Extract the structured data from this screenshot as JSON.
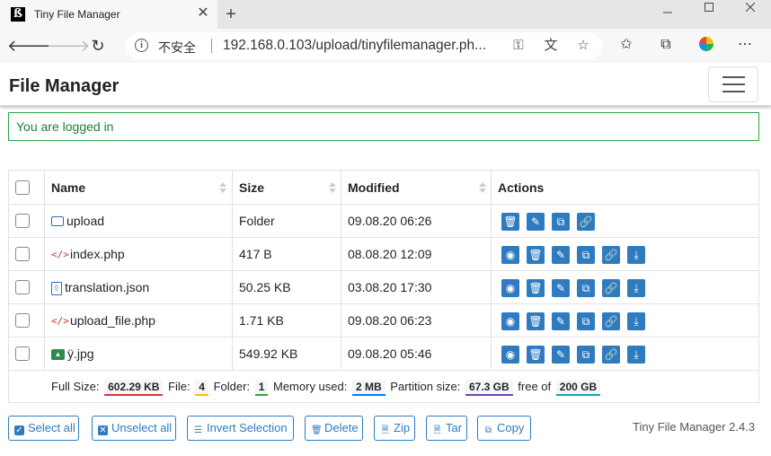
{
  "browser": {
    "tab_title": "Tiny File Manager",
    "tab_close": "✕",
    "new_tab": "+",
    "favicon_text": "ß",
    "security_label": "不安全",
    "url": "192.168.0.103/upload/tinyfilemanager.ph..."
  },
  "app": {
    "brand": "File Manager",
    "alert": "You are logged in"
  },
  "table": {
    "headers": {
      "name": "Name",
      "size": "Size",
      "modified": "Modified",
      "actions": "Actions"
    },
    "rows": [
      {
        "name": "upload",
        "icon": "folder-icon",
        "size": "Folder",
        "modified": "09.08.20 06:26",
        "actions": [
          "delete",
          "rename",
          "copy",
          "link"
        ]
      },
      {
        "name": "index.php",
        "icon": "code-file-icon",
        "size": "417 B",
        "modified": "08.08.20 12:09",
        "actions": [
          "view",
          "delete",
          "rename",
          "copy",
          "link",
          "download"
        ]
      },
      {
        "name": "translation.json",
        "icon": "json-file-icon",
        "size": "50.25 KB",
        "modified": "03.08.20 17:30",
        "actions": [
          "view",
          "delete",
          "rename",
          "copy",
          "link",
          "download"
        ]
      },
      {
        "name": "upload_file.php",
        "icon": "code-file-icon",
        "size": "1.71 KB",
        "modified": "09.08.20 06:23",
        "actions": [
          "view",
          "delete",
          "rename",
          "copy",
          "link",
          "download"
        ]
      },
      {
        "name": "ÿ.jpg",
        "icon": "image-file-icon",
        "size": "549.92 KB",
        "modified": "09.08.20 05:46",
        "actions": [
          "view",
          "delete",
          "rename",
          "copy",
          "link",
          "download"
        ]
      }
    ],
    "footer": {
      "full_size_label": "Full Size:",
      "full_size": "602.29 KB",
      "file_label": "File:",
      "file_count": "4",
      "folder_label": "Folder:",
      "folder_count": "1",
      "memory_label": "Memory used:",
      "memory": "2 MB",
      "partition_label": "Partition size:",
      "partition": "67.3 GB",
      "free_label": "free of",
      "free_total": "200 GB"
    }
  },
  "buttons": {
    "select_all": "Select all",
    "unselect_all": "Unselect all",
    "invert": "Invert Selection",
    "delete": "Delete",
    "zip": "Zip",
    "tar": "Tar",
    "copy": "Copy"
  },
  "version": "Tiny File Manager 2.4.3",
  "colors": {
    "accent": "#2f7bbf",
    "alert_border": "#28a745",
    "full_size_underline": "#dc3545",
    "file_underline": "#ffc107",
    "folder_underline": "#28a745",
    "memory_underline": "#007bff",
    "partition_underline": "#6f42c1",
    "free_underline": "#17a2b8"
  }
}
